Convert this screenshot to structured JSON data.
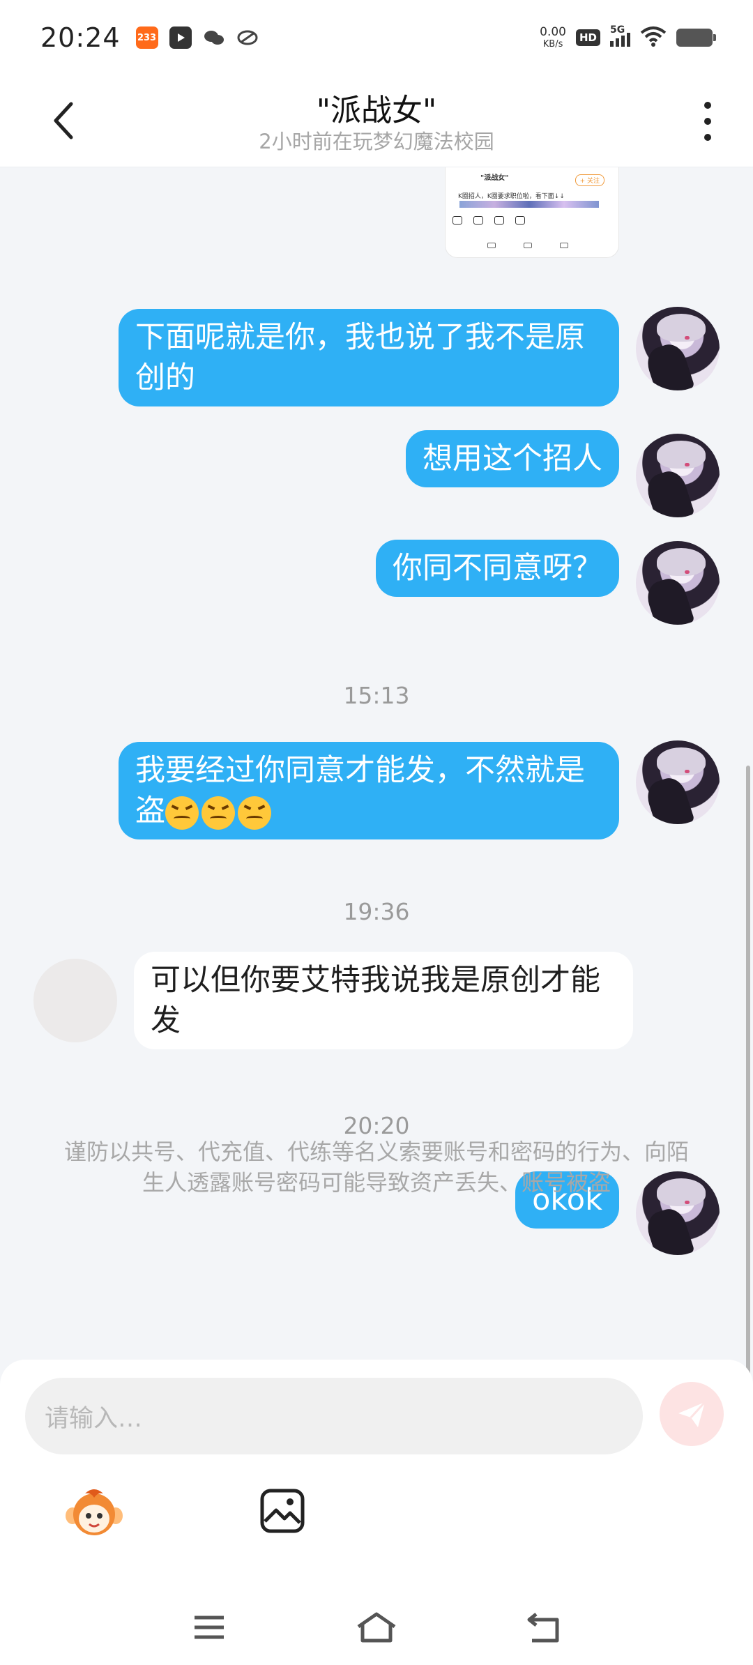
{
  "status_bar": {
    "time": "20:24",
    "app_badges": [
      "233",
      "play",
      "wechat",
      "link"
    ],
    "net_speed_value": "0.00",
    "net_speed_unit": "KB/s",
    "hd_label": "HD",
    "network_label": "5G"
  },
  "header": {
    "title": "\"派战女\"",
    "subtitle": "2小时前在玩梦幻魔法校园"
  },
  "shared_image": {
    "name_text": "\"派战女\"",
    "follow_label": "+ 关注",
    "caption": "K圈招人，K圈要求职位啦，看下面↓↓"
  },
  "messages": [
    {
      "from": "me",
      "text": "下面呢就是你，我也说了我不是原创的"
    },
    {
      "from": "me",
      "text": "想用这个招人"
    },
    {
      "from": "me",
      "text": "你同不同意呀？"
    },
    {
      "type": "time",
      "text": "15:13"
    },
    {
      "from": "me",
      "text": "我要经过你同意才能发，不然就是盗",
      "emoji": [
        "confounded-face",
        "confounded-face",
        "confounded-face"
      ]
    },
    {
      "type": "time",
      "text": "19:36"
    },
    {
      "from": "other",
      "text": "可以但你要艾特我说我是原创才能发"
    },
    {
      "type": "time",
      "text": "20:20"
    },
    {
      "from": "me",
      "text": "okok"
    }
  ],
  "notice": "谨防以共号、代充值、代练等名义索要账号和密码的行为、向陌生人透露账号密码可能导致资产丢失、账号被盗",
  "input": {
    "placeholder": "请输入…"
  },
  "colors": {
    "my_bubble": "#2fb0f5",
    "their_bubble": "#ffffff",
    "send_button": "#fde3e3"
  }
}
